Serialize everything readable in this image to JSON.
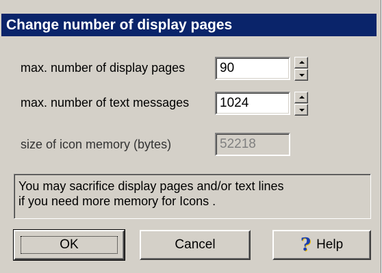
{
  "dialog": {
    "title": "Change number of display pages"
  },
  "fields": {
    "display_pages": {
      "label": "max. number of display pages",
      "value": "90"
    },
    "text_messages": {
      "label": "max. number of text messages",
      "value": "1024"
    },
    "icon_memory": {
      "label": "size of icon memory (bytes)",
      "value": "52218"
    }
  },
  "message": {
    "line1": "You may sacrifice display pages and/or text lines",
    "line2": "if you need more memory for Icons ."
  },
  "buttons": {
    "ok": "OK",
    "cancel": "Cancel",
    "help": "Help"
  },
  "icons": {
    "spin_up": "spin-up-arrow",
    "spin_down": "spin-down-arrow",
    "help": "question-mark-icon"
  },
  "colors": {
    "title_bar": "#0a246a",
    "dialog_face": "#d4d0c8"
  }
}
